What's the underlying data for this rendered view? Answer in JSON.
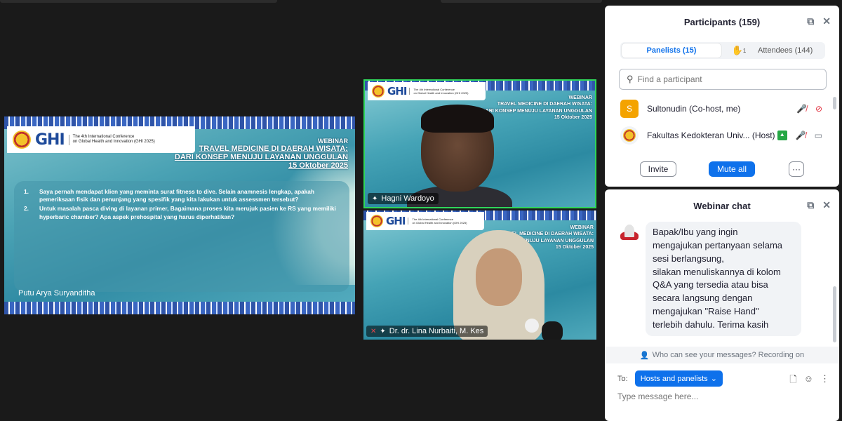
{
  "slide": {
    "conference_line1": "The 4th International Conference",
    "conference_line2": "on Global Health and Innovation (GHI 2025)",
    "ghi_logo": "GHI",
    "webinar_label": "WEBINAR",
    "title_line1": "TRAVEL MEDICINE DI DAERAH WISATA:",
    "title_line2": "DARI KONSEP MENUJU LAYANAN UNGGULAN",
    "date": "15 Oktober 2025",
    "questions": [
      {
        "num": "1.",
        "text": "Saya pernah mendapat klien yang meminta surat fitness to dive. Selain anamnesis lengkap, apakah pemeriksaan fisik dan penunjang yang spesifik yang kita lakukan untuk assessmen tersebut?"
      },
      {
        "num": "2.",
        "text": "Untuk masalah pasca diving di layanan primer, Bagaimana proses kita merujuk pasien ke RS yang memiliki hyperbaric chamber? Apa aspek prehospital yang harus diperhatikan?"
      }
    ],
    "asker": "Putu Arya Suryanditha"
  },
  "tiles": [
    {
      "name": "Hagni Wardoyo",
      "active": true
    },
    {
      "name": "Dr. dr. Lina Nurbaiti, M. Kes",
      "active": false
    }
  ],
  "participants": {
    "title": "Participants (159)",
    "tab_panelists": "Panelists (15)",
    "raised_hands": "1",
    "tab_attendees": "Attendees (144)",
    "search_placeholder": "Find a participant",
    "list": [
      {
        "initial": "S",
        "name": "Sultonudin (Co-host, me)"
      },
      {
        "name": "Fakultas Kedokteran Univ...",
        "role": "(Host)"
      }
    ],
    "invite_label": "Invite",
    "mute_all_label": "Mute all",
    "more_label": "···"
  },
  "chat": {
    "title": "Webinar chat",
    "message_lines": [
      "Bapak/Ibu yang ingin",
      "mengajukan pertanyaan selama",
      "sesi berlangsung,",
      "silakan menuliskannya di kolom",
      "Q&A yang tersedia atau bisa",
      "secara langsung dengan",
      "mengajukan \"Raise Hand\"",
      "terlebih dahulu. Terima kasih"
    ],
    "notice": "Who can see your messages? Recording on",
    "to_label": "To:",
    "to_value": "Hosts and panelists",
    "input_placeholder": "Type message here..."
  },
  "colors": {
    "accent": "#0e71eb",
    "active_speaker": "#2fd65a",
    "muted": "#e02d3c",
    "cohost_avatar": "#f4a300"
  }
}
